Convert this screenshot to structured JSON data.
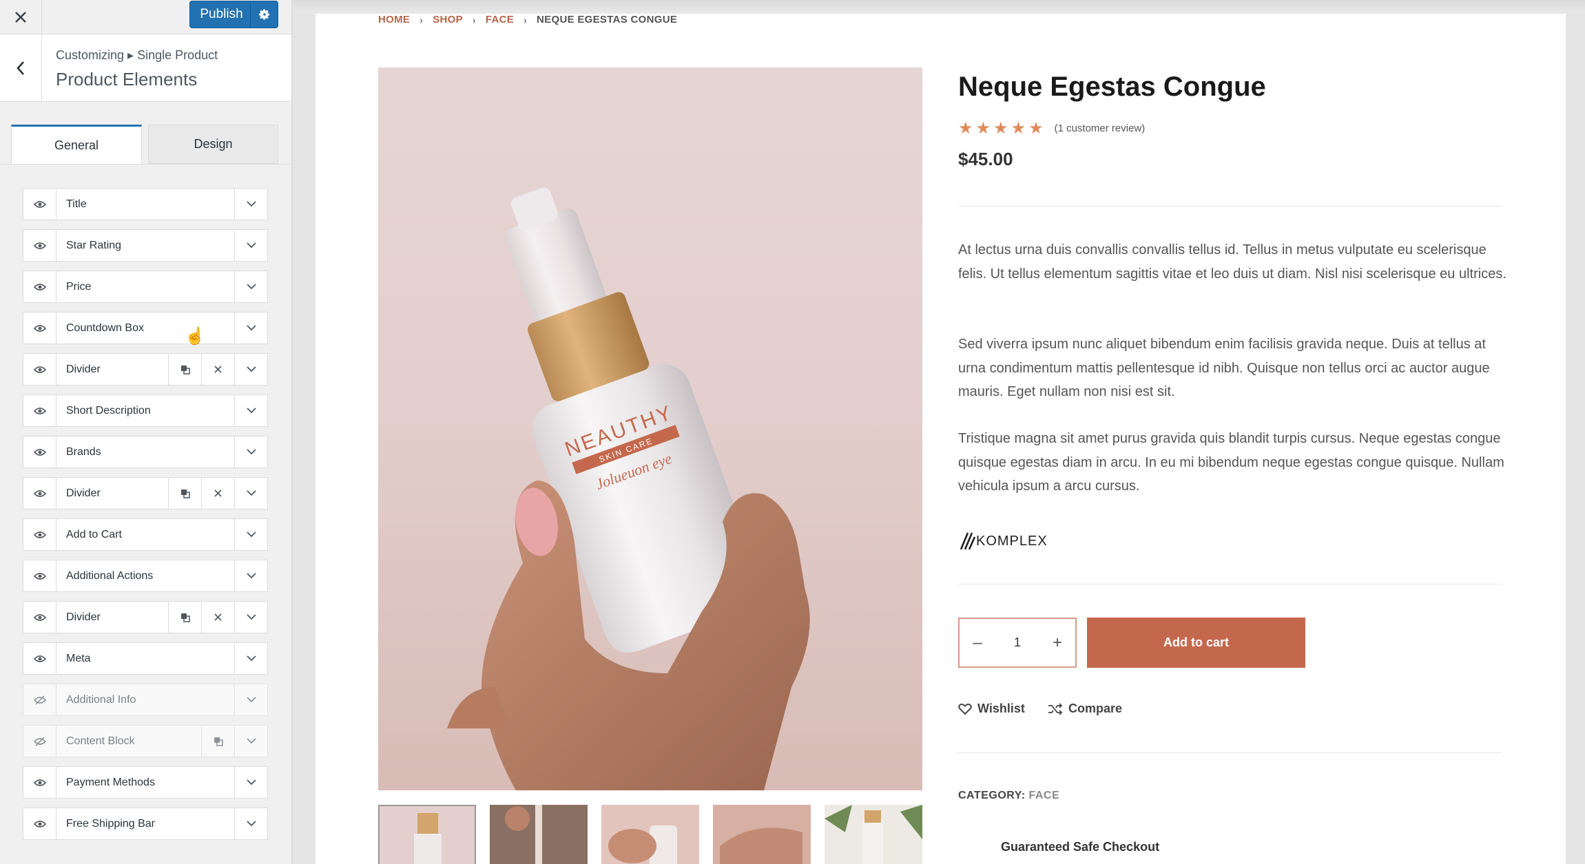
{
  "customizer": {
    "publish_label": "Publish",
    "breadcrumb": "Customizing ▸ Single Product",
    "section_title": "Product Elements",
    "tabs": [
      {
        "label": "General"
      },
      {
        "label": "Design"
      }
    ],
    "elements": [
      {
        "label": "Title"
      },
      {
        "label": "Star Rating"
      },
      {
        "label": "Price"
      },
      {
        "label": "Countdown Box"
      },
      {
        "label": "Divider"
      },
      {
        "label": "Short Description"
      },
      {
        "label": "Brands"
      },
      {
        "label": "Divider"
      },
      {
        "label": "Add to Cart"
      },
      {
        "label": "Additional Actions"
      },
      {
        "label": "Divider"
      },
      {
        "label": "Meta"
      },
      {
        "label": "Additional Info"
      },
      {
        "label": "Content Block"
      },
      {
        "label": "Payment Methods"
      },
      {
        "label": "Free Shipping Bar"
      }
    ]
  },
  "preview": {
    "breadcrumb": {
      "home": "HOME",
      "shop": "SHOP",
      "face": "FACE",
      "current": "NEQUE EGESTAS CONGUE"
    },
    "bottle": {
      "brand": "NEAUTHY",
      "subtitle": "SKIN CARE",
      "script": "Jolueuon eye"
    },
    "product": {
      "title": "Neque Egestas Congue",
      "review_text": "(1 customer review)",
      "rating": 5,
      "price": "$45.00",
      "description": [
        "At lectus urna duis convallis convallis tellus id. Tellus in metus vulputate eu scelerisque felis. Ut tellus elementum sagittis vitae et leo duis ut diam. Nisl nisi scelerisque eu ultrices.",
        "Sed viverra ipsum nunc aliquet bibendum enim facilisis gravida neque. Duis at tellus at urna condimentum mattis pellentesque id nibh. Quisque non tellus orci ac auctor augue mauris. Eget nullam non nisi est sit.",
        "Tristique magna sit amet purus gravida quis blandit turpis cursus. Neque egestas congue quisque egestas diam in arcu. In eu mi bibendum neque egestas congue quisque. Nullam vehicula ipsum a arcu cursus."
      ],
      "brand": "KOMPLEX",
      "quantity": "1",
      "add_to_cart": "Add to cart",
      "wishlist": "Wishlist",
      "compare": "Compare",
      "category_label": "CATEGORY:",
      "category_value": "FACE",
      "safe_checkout": "Guaranteed Safe Checkout"
    }
  },
  "colors": {
    "publish": "#2271b1",
    "accent": "#c4684d",
    "star": "#e08a5b"
  }
}
